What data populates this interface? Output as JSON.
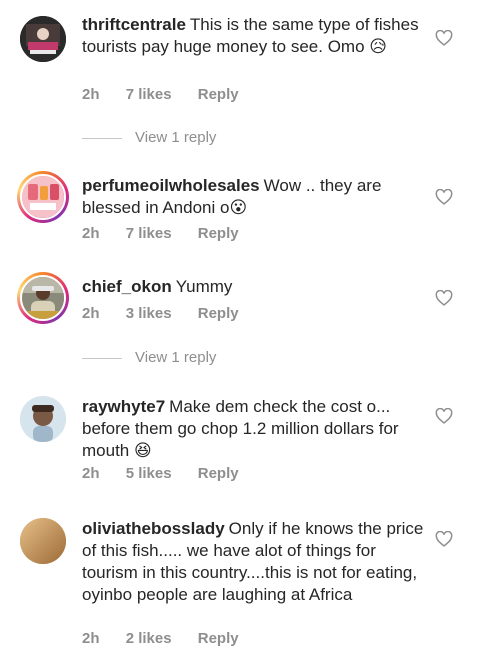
{
  "comments": [
    {
      "username": "thriftcentrale",
      "text": "This is the same type of fishes tourists pay huge money to see. Omo",
      "emoji": "😥",
      "time": "2h",
      "likes": "7 likes",
      "reply": "Reply",
      "view_replies": "View 1 reply"
    },
    {
      "username": "perfumeoilwholesales",
      "text": "Wow .. they are blessed in Andoni o",
      "emoji": "😮",
      "time": "2h",
      "likes": "7 likes",
      "reply": "Reply"
    },
    {
      "username": "chief_okon",
      "text": "Yummy",
      "time": "2h",
      "likes": "3 likes",
      "reply": "Reply",
      "view_replies": "View 1 reply"
    },
    {
      "username": "raywhyte7",
      "text": "Make dem check the cost o... before them go chop 1.2 million dollars for mouth",
      "emoji": "😆",
      "time": "2h",
      "likes": "5 likes",
      "reply": "Reply"
    },
    {
      "username": "oliviathebosslady",
      "text": "Only if he knows the price of this fish..... we have alot of things for tourism in this country....this is not for eating,  oyinbo people are laughing at Africa",
      "time": "2h",
      "likes": "2 likes",
      "reply": "Reply"
    }
  ],
  "icons": {
    "like": "heart-outline-icon"
  },
  "colors": {
    "text": "#262626",
    "secondary": "#8e8e8e",
    "story_ring": "#dd2a7b"
  }
}
